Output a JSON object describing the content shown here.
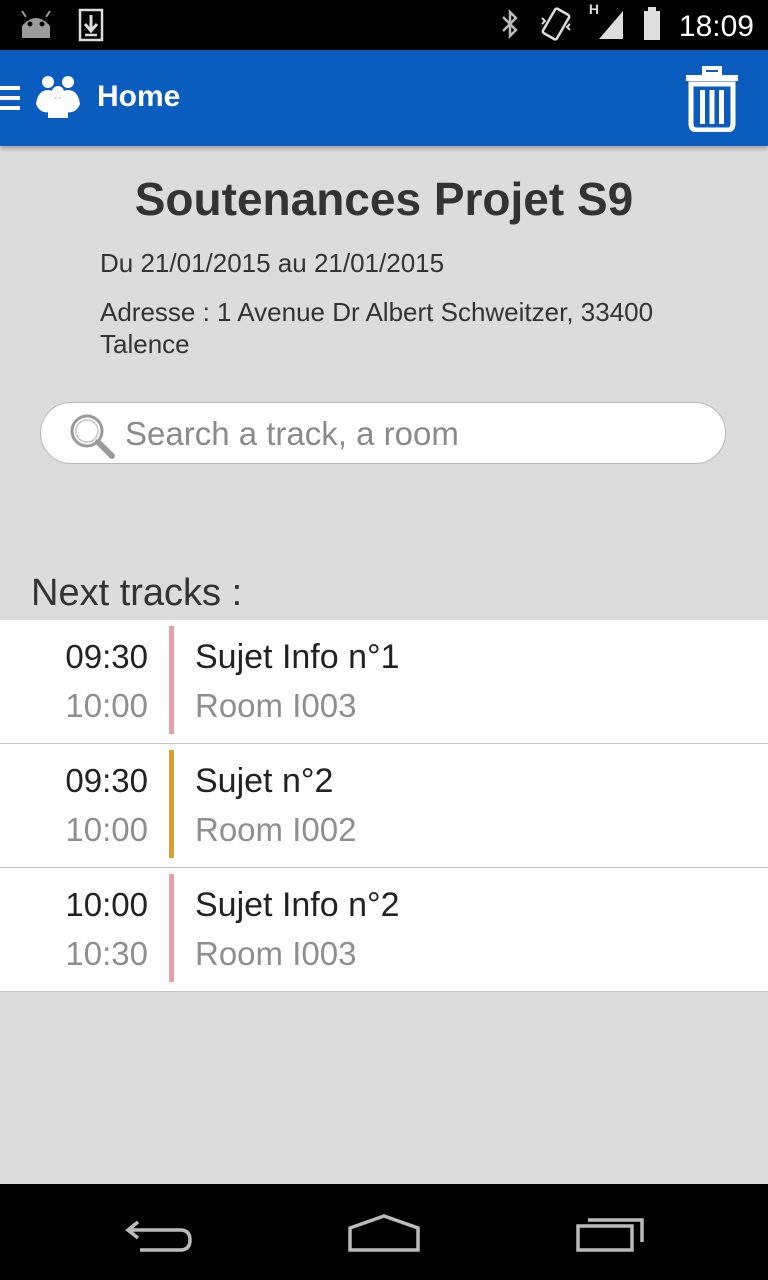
{
  "status_bar": {
    "time": "18:09",
    "network_label": "H",
    "icons": [
      "android-icon",
      "download-icon",
      "bluetooth-icon",
      "vibrate-icon",
      "signal-icon",
      "battery-icon"
    ]
  },
  "app_bar": {
    "title": "Home",
    "color": "#0a5cbf",
    "icons": [
      "menu-icon",
      "app-logo-icon",
      "trash-icon"
    ]
  },
  "event": {
    "title": "Soutenances Projet S9",
    "dates": "Du 21/01/2015 au 21/01/2015",
    "address": "Adresse : 1 Avenue Dr Albert Schweitzer, 33400 Talence"
  },
  "search": {
    "placeholder": "Search a track, a room",
    "value": ""
  },
  "next_tracks": {
    "label": "Next tracks :",
    "items": [
      {
        "start": "09:30",
        "end": "10:00",
        "name": "Sujet Info n°1",
        "room": "Room I003",
        "color": "#e8a0a8"
      },
      {
        "start": "09:30",
        "end": "10:00",
        "name": "Sujet n°2",
        "room": "Room I002",
        "color": "#d9a030"
      },
      {
        "start": "10:00",
        "end": "10:30",
        "name": "Sujet Info n°2",
        "room": "Room I003",
        "color": "#e8a0a8"
      }
    ]
  },
  "nav_bar": {
    "icons": [
      "back-icon",
      "home-icon",
      "recents-icon"
    ]
  }
}
